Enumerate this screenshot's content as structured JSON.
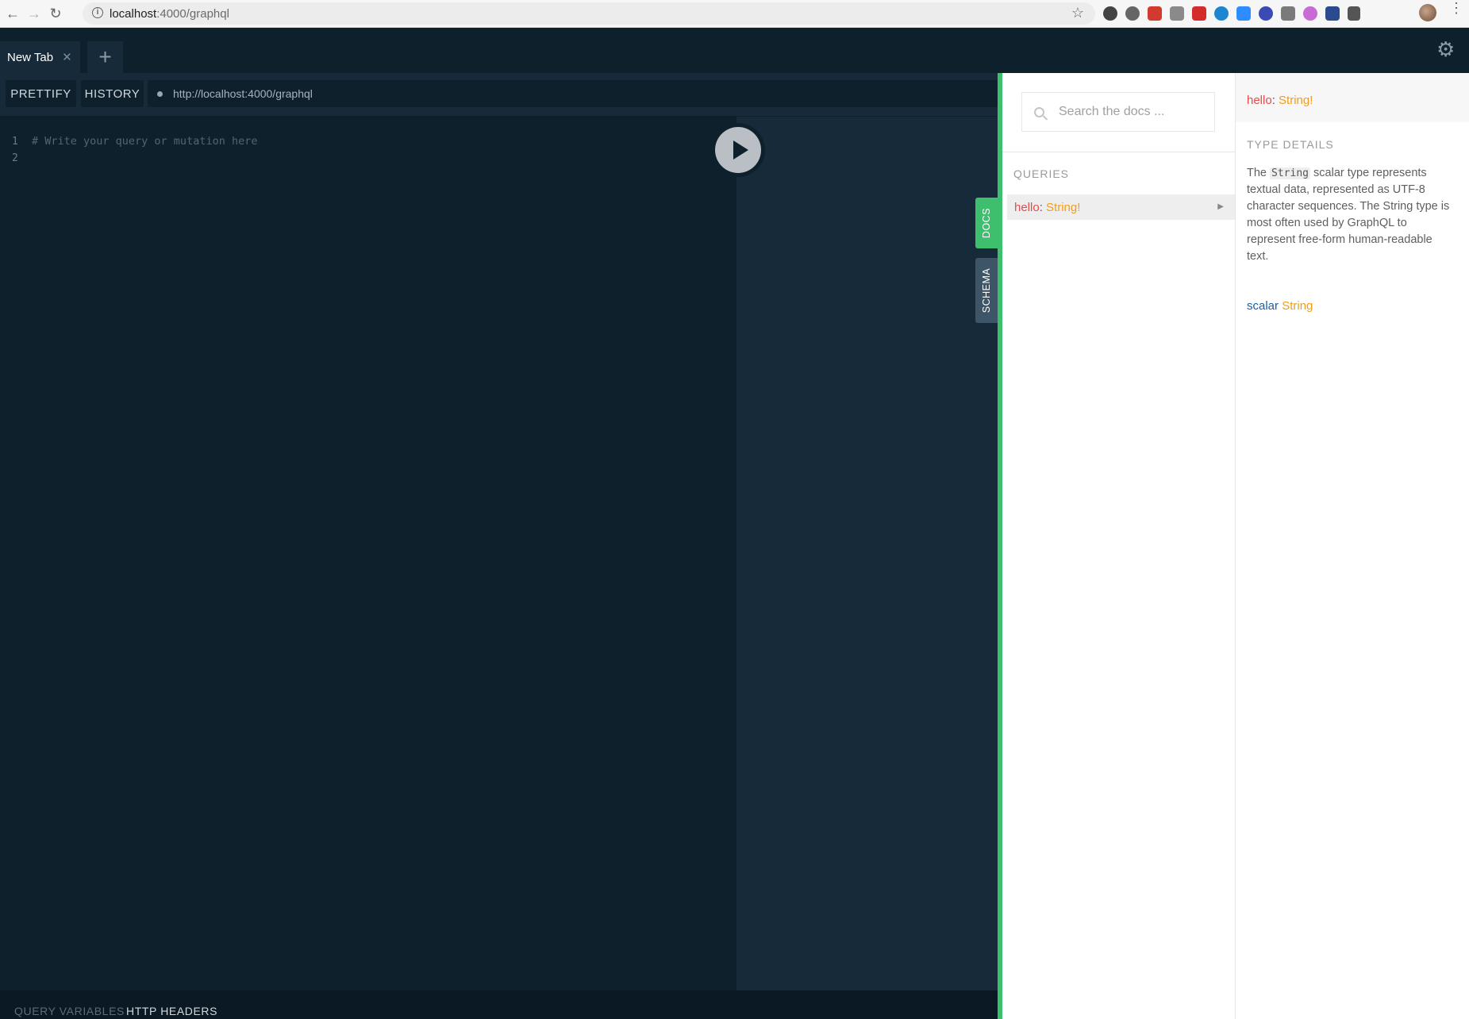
{
  "browser": {
    "url_host": "localhost",
    "url_path": ":4000/graphql",
    "back_icon": "arrow-left-icon",
    "forward_icon": "arrow-right-icon",
    "reload_icon": "reload-icon",
    "bookmark_icon": "star-icon",
    "menu_icon": "kebab-icon"
  },
  "tabs": [
    {
      "label": "New Tab",
      "close_icon": "close-icon"
    }
  ],
  "add_tab_label": "+",
  "toolbar": {
    "prettify_label": "PRETTIFY",
    "history_label": "HISTORY",
    "endpoint": "http://localhost:4000/graphql"
  },
  "editor": {
    "lines": [
      "1",
      "2"
    ],
    "placeholder": "# Write your query or mutation here"
  },
  "bottom": {
    "query_variables": "QUERY VARIABLES",
    "http_headers": "HTTP HEADERS"
  },
  "side_tabs": {
    "docs": "DOCS",
    "schema": "SCHEMA"
  },
  "docs": {
    "search_placeholder": "Search the docs ...",
    "queries_title": "QUERIES",
    "query_field": "hello",
    "query_colon": ":",
    "query_type": "String!"
  },
  "details": {
    "field": "hello",
    "colon": ":",
    "type": "String!",
    "type_details_title": "TYPE DETAILS",
    "desc_pre": "The",
    "desc_code": "String",
    "desc_post": "scalar type represents textual data, represented as UTF-8 character sequences. The String type is most often used by GraphQL to represent free-form human-readable text.",
    "scalar_kw": "scalar",
    "scalar_name": "String"
  },
  "colors": {
    "editor_bg": "#0f202d",
    "panel_bg": "#172a3a",
    "docs_accent": "#3dbf6e",
    "field_red": "#e54c4c",
    "type_orange": "#f19d1b",
    "keyword_blue": "#1d5fa6"
  }
}
